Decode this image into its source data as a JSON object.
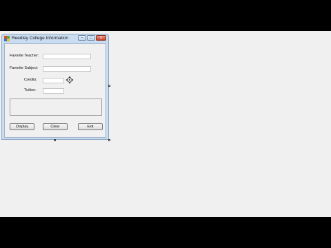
{
  "form": {
    "title": "Reedley College Information",
    "caption_buttons": {
      "minimize": "–",
      "maximize": "□",
      "close": "x"
    }
  },
  "fields": {
    "teacher_label": "Favorite Teacher:",
    "subject_label": "Favorite Subject:",
    "credits_label": "Credits:",
    "tuition_label": "Tuition:"
  },
  "buttons": {
    "display": "Display",
    "clear": "Clear",
    "exit": "Exit"
  },
  "icons": [
    "app-icon",
    "minimize-icon",
    "maximize-icon",
    "close-icon",
    "move-cursor-icon"
  ]
}
